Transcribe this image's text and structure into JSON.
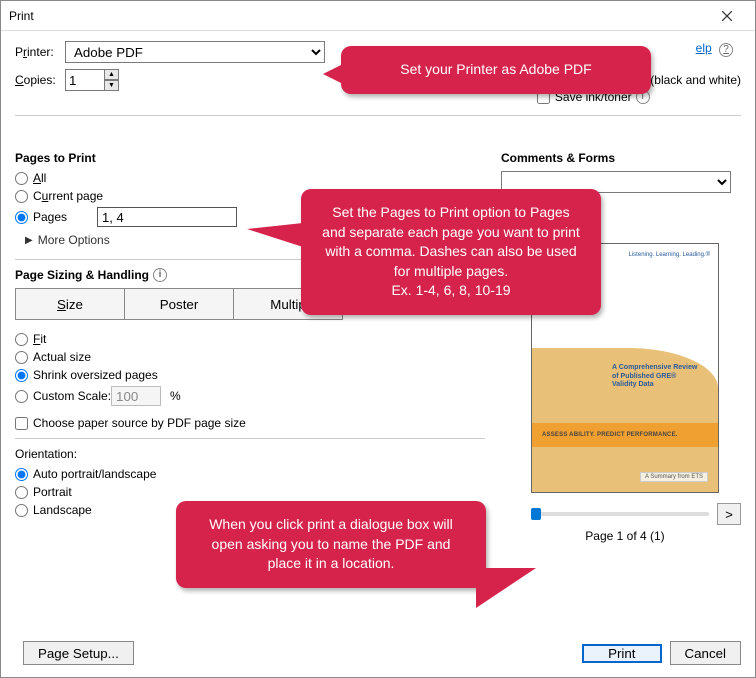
{
  "window": {
    "title": "Print"
  },
  "top": {
    "printer_label_html": "P<u>r</u>inter:",
    "printer_value": "Adobe PDF",
    "copies_label_html": "<u>C</u>opies:",
    "copies_value": "1",
    "print_grayscale_label": "Print in grayscale (black and white)",
    "save_ink_label": "Save ink/toner",
    "help_label": "elp"
  },
  "pagesToPrint": {
    "heading": "Pages to Print",
    "all_label_html": "<u>A</u>ll",
    "current_label_html": "C<u>u</u>rrent page",
    "pages_label": "Pages",
    "pages_value": "1, 4",
    "selected": "pages",
    "more_options": "More Options"
  },
  "sizing": {
    "heading": "Page Sizing & Handling",
    "btn_size_html": "<u>S</u>ize",
    "btn_poster": "Poster",
    "btn_multiple": "Multip",
    "fit_label_html": "<u>F</u>it",
    "actual_label": "Actual size",
    "shrink_label": "Shrink oversized pages",
    "custom_label": "Custom Scale:",
    "custom_value": "100",
    "custom_suffix": "%",
    "selected": "shrink",
    "choose_paper_label": "Choose paper source by PDF page size"
  },
  "orientation": {
    "heading": "Orientation:",
    "auto_label": "Auto portrait/landscape",
    "portrait_label": "Portrait",
    "landscape_label": "Landscape",
    "selected": "auto"
  },
  "comments": {
    "heading": "Comments & Forms",
    "selected": ""
  },
  "preview": {
    "tagline": "Listening. Learning. Leading.®",
    "title_line1": "A Comprehensive Review",
    "title_line2": "of Published GRE®",
    "title_line3": "Validity Data",
    "orange_text": "ASSESS ABILITY. PREDICT PERFORMANCE.",
    "summary": "A Summary from ETS",
    "page_info": "Page 1 of 4 (1)",
    "slider_next": ">"
  },
  "footer": {
    "page_setup_label": "Page Setup...",
    "print_label": "Print",
    "cancel_label": "Cancel"
  },
  "callouts": {
    "c1": "Set your Printer as Adobe PDF",
    "c2": "Set the Pages to Print option to Pages and separate each page you want to print with a comma. Dashes can also be used for multiple pages.\nEx. 1-4, 6, 8, 10-19",
    "c3": "When you click print a dialogue box will open asking you to name the PDF and place it in a location."
  }
}
